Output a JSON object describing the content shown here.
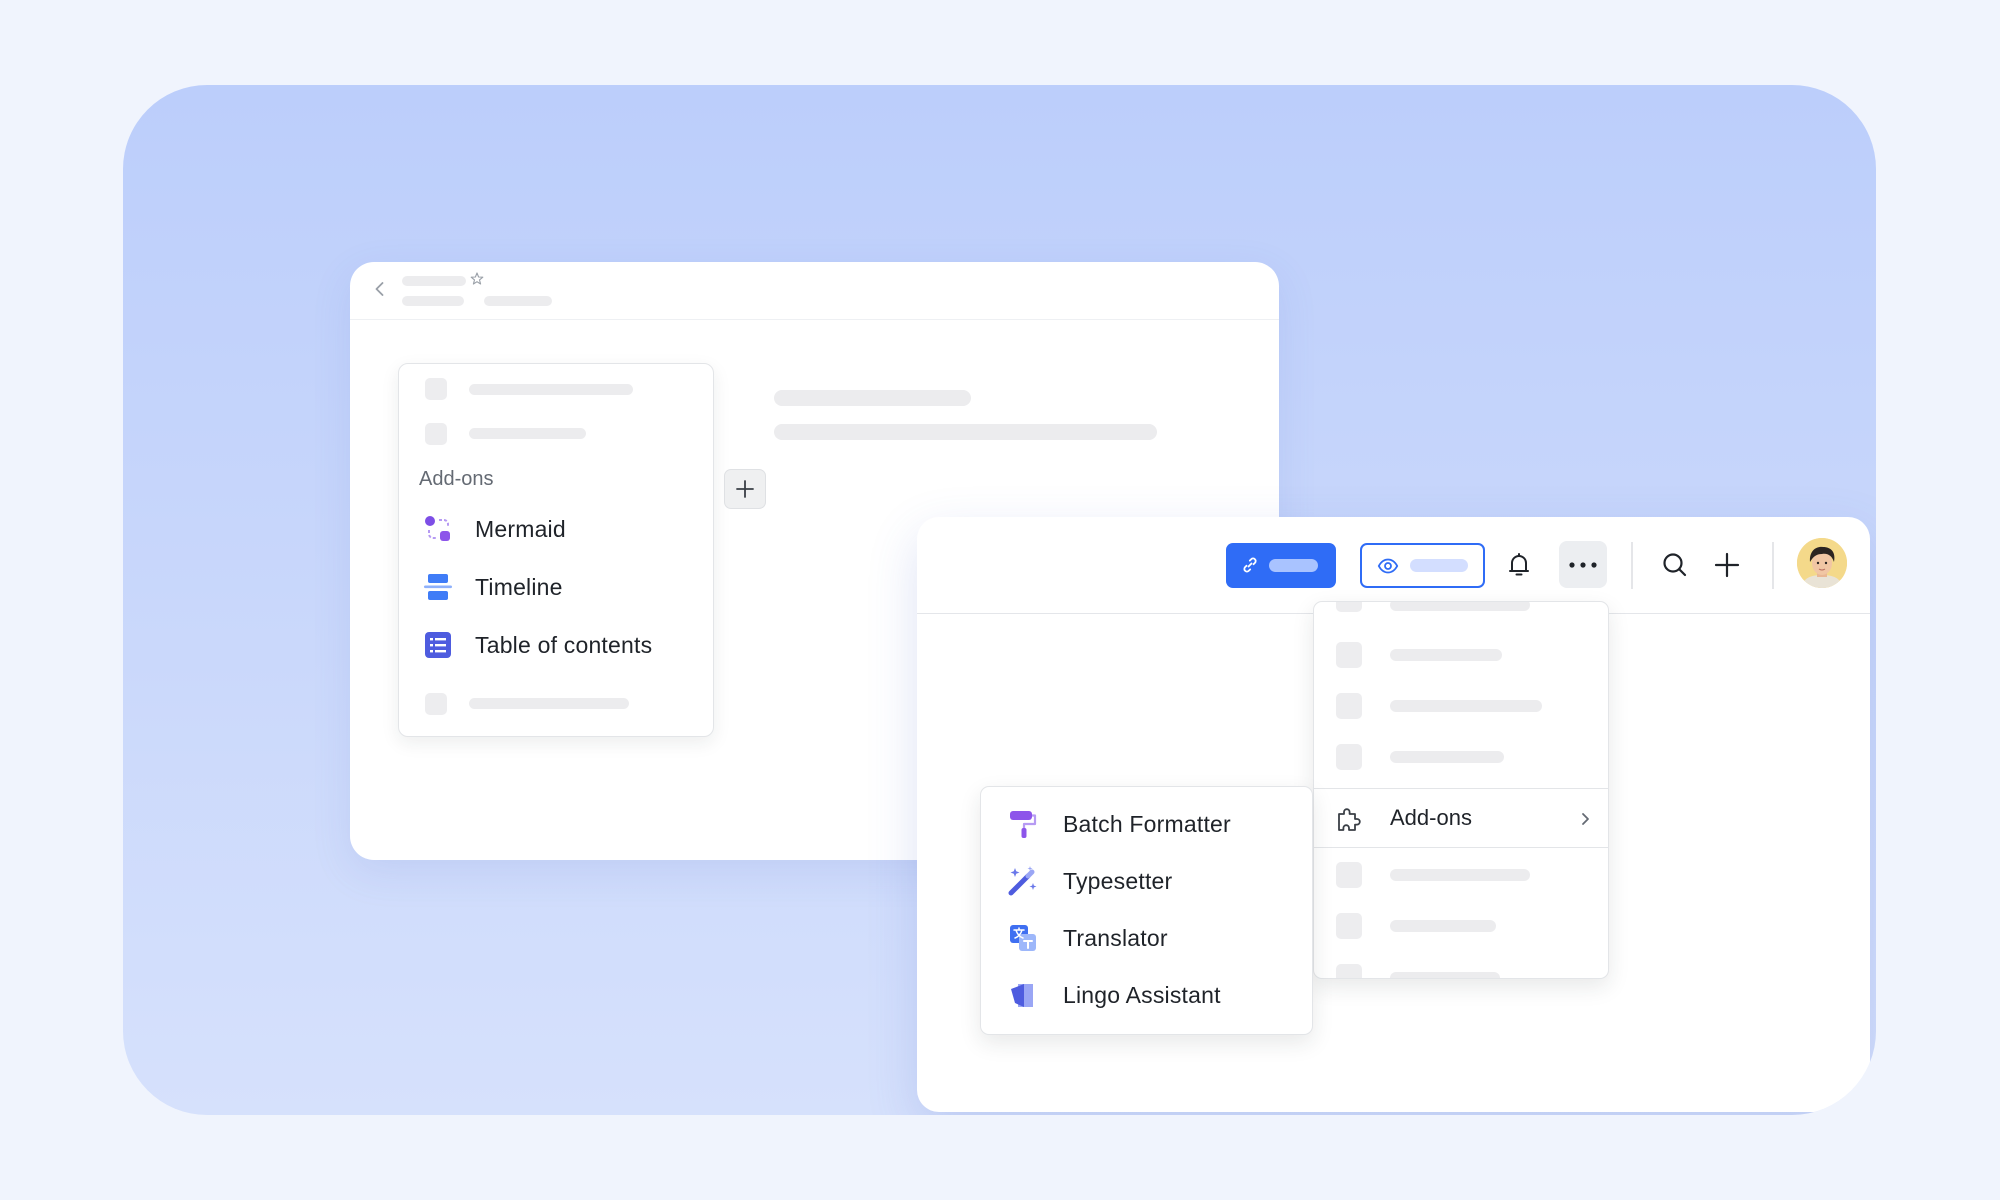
{
  "left_panel": {
    "section_title": "Add-ons",
    "addons": [
      {
        "label": "Mermaid",
        "icon": "mermaid-icon"
      },
      {
        "label": "Timeline",
        "icon": "timeline-icon"
      },
      {
        "label": "Table of contents",
        "icon": "table-of-contents-icon"
      }
    ]
  },
  "more_menu": {
    "addons_label": "Add-ons",
    "addons_icon": "puzzle-icon"
  },
  "addons_submenu": {
    "items": [
      {
        "label": "Batch Formatter",
        "icon": "paint-roller-icon"
      },
      {
        "label": "Typesetter",
        "icon": "magic-wand-icon"
      },
      {
        "label": "Translator",
        "icon": "translate-icon"
      },
      {
        "label": "Lingo Assistant",
        "icon": "lingo-book-icon"
      }
    ]
  },
  "toolbar": {
    "icons": [
      "link-icon",
      "eye-icon",
      "bell-icon",
      "more-icon",
      "search-icon",
      "plus-icon",
      "avatar"
    ]
  },
  "colors": {
    "accent": "#2f6cf6",
    "purple": "#8d55ea",
    "indigo": "#4e5cdf",
    "background": "#f0f4fd",
    "stage": "#bccefb"
  }
}
